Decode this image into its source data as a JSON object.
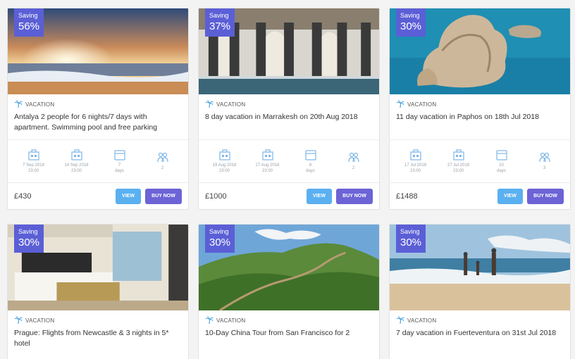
{
  "badge_label": "Saving",
  "category_label": "VACATION",
  "view_label": "VIEW",
  "buy_label": "BUY NOW",
  "cards": [
    {
      "discount": "56%",
      "title": "Antalya 2 people for 6 nights/7 days with apartment. Swimming pool and free parking",
      "checkin_date": "7 Sep 2018",
      "checkin_time": "23:00",
      "checkout_date": "14 Sep 2018",
      "checkout_time": "23:00",
      "days_value": "7",
      "days_unit": "days",
      "people": "2",
      "price": "£430"
    },
    {
      "discount": "37%",
      "title": "8 day vacation in Marrakesh on 20th Aug 2018",
      "checkin_date": "19 Aug 2018",
      "checkin_time": "23:00",
      "checkout_date": "27 Aug 2018",
      "checkout_time": "23:00",
      "days_value": "8",
      "days_unit": "days",
      "people": "2",
      "price": "£1000"
    },
    {
      "discount": "30%",
      "title": "11 day vacation in Paphos on 18th Jul 2018",
      "checkin_date": "17 Jul 2018",
      "checkin_time": "23:00",
      "checkout_date": "27 Jul 2018",
      "checkout_time": "23:00",
      "days_value": "10",
      "days_unit": "days",
      "people": "3",
      "price": "£1488"
    },
    {
      "discount": "30%",
      "title": "Prague: Flights from Newcastle & 3 nights in 5* hotel"
    },
    {
      "discount": "30%",
      "title": "10-Day China Tour from San Francisco for 2"
    },
    {
      "discount": "30%",
      "title": "7 day vacation in Fuerteventura on 31st Jul 2018"
    }
  ]
}
